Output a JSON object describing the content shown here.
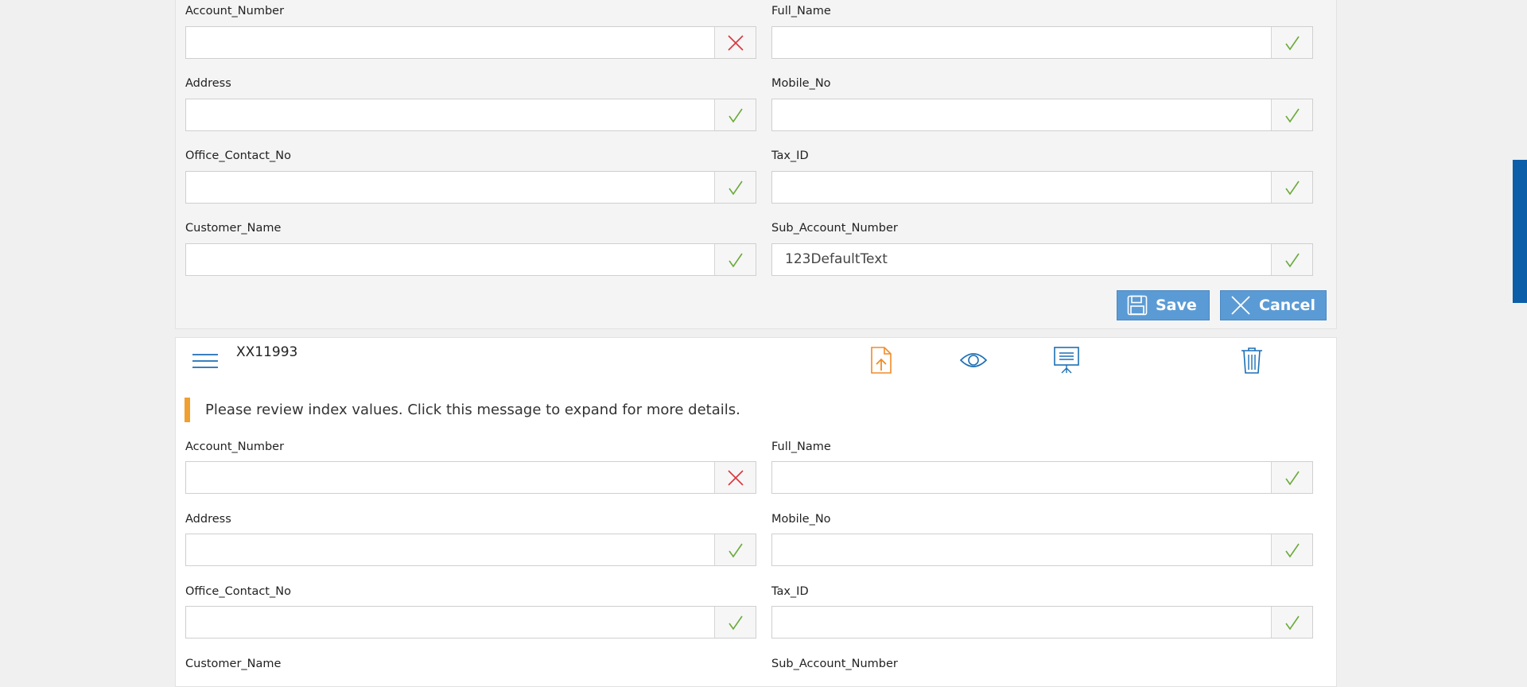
{
  "top_form": {
    "fields": [
      {
        "label": "Account_Number",
        "value": "",
        "status": "invalid"
      },
      {
        "label": "Full_Name",
        "value": "",
        "status": "valid"
      },
      {
        "label": "Address",
        "value": "",
        "status": "valid"
      },
      {
        "label": "Mobile_No",
        "value": "",
        "status": "valid"
      },
      {
        "label": "Office_Contact_No",
        "value": "",
        "status": "valid"
      },
      {
        "label": "Tax_ID",
        "value": "",
        "status": "valid"
      },
      {
        "label": "Customer_Name",
        "value": "",
        "status": "valid"
      },
      {
        "label": "Sub_Account_Number",
        "value": "123DefaultText",
        "status": "valid"
      }
    ],
    "save_label": "Save",
    "cancel_label": "Cancel"
  },
  "document": {
    "title": "XX11993",
    "message": "Please review index values. Click this message to expand for more details.",
    "toolbar": {
      "icons": [
        "menu-icon",
        "upload-document-icon",
        "eye-icon",
        "presentation-icon",
        "trash-icon"
      ]
    },
    "fields": [
      {
        "label": "Account_Number",
        "value": "",
        "status": "invalid"
      },
      {
        "label": "Full_Name",
        "value": "",
        "status": "valid"
      },
      {
        "label": "Address",
        "value": "",
        "status": "valid"
      },
      {
        "label": "Mobile_No",
        "value": "",
        "status": "valid"
      },
      {
        "label": "Office_Contact_No",
        "value": "",
        "status": "valid"
      },
      {
        "label": "Tax_ID",
        "value": "",
        "status": "valid"
      },
      {
        "label": "Customer_Name",
        "value": "",
        "status": "valid"
      },
      {
        "label": "Sub_Account_Number",
        "value": "",
        "status": "valid"
      }
    ]
  },
  "colors": {
    "accent": "#5b9bd5",
    "valid": "#6aaa3a",
    "invalid": "#d9373e",
    "warning": "#f0a030",
    "icon_orange": "#f08c28",
    "icon_blue": "#1c6fb5"
  }
}
